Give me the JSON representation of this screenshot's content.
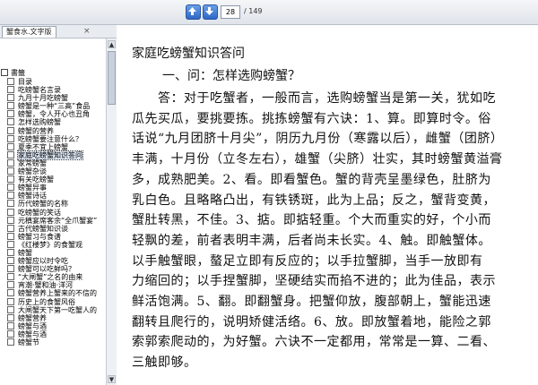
{
  "toolbar": {
    "current_page": "28",
    "total_pages": "/ 149",
    "prev_icon": "arrow-up-icon",
    "next_icon": "arrow-down-icon"
  },
  "sidebar": {
    "tab_label": "蟹食水.文字版",
    "root_label": "書籤",
    "items": [
      "目录",
      "吃螃蟹名言录",
      "九月十月吃螃蟹",
      "螃蟹是一种“三高”食品",
      "螃蟹，令人开心也丑角",
      "怎样选购螃蟹",
      "螃蟹的营养",
      "吃螃蟹要注意什么？",
      "夏季不宜上螃蟹",
      "家庭吃螃蟹知识答问",
      "家常螃蟹",
      "螃蟹杂谈",
      "有关吃螃蟹",
      "螃蟹异事",
      "螃蟹诗话",
      "历代螃蟹的名称",
      "吃螃蟹的笑话",
      "元稹宴席客余“全爪蟹宴”",
      "古代螃蟹知识谈",
      "螃蟹习与食谱",
      "《红楼梦》的食蟹观",
      "螃蟹",
      "螃蟹应以时令吃",
      "螃蟹可以吃鲜吗？",
      "“大闸蟹”之名的由来",
      "宵潮·蟹和油·洋河",
      "螃蟹营养上蟹来的不信的",
      "历史上的食蟹风俗",
      "大闸蟹天下第一吃蟹人的",
      "螃蟹营养",
      "螃蟹与酒",
      "螃蟹与酒",
      "螃蟹节"
    ],
    "selected_index": 9
  },
  "document": {
    "title": "家庭吃螃蟹知识答问",
    "question": "一、问：怎样选购螃蟹？",
    "lines": [
      "　　答：对于吃蟹者，一般而言，选购螃蟹当是第一关，犹如吃",
      "瓜先买瓜，要挑要拣。挑拣螃蟹有六诀：1、算。即算时令。俗",
      "话说“九月团脐十月尖”，阴历九月份（寒露以后），雌蟹（团脐）",
      "丰满，十月份（立冬左右），雄蟹（尖脐）壮实，其时螃蟹黄溢膏",
      "多，成熟肥美。2、看。即看蟹色。蟹的背壳呈墨绿色，肚脐为",
      "乳白色。且略略凸出，有铁锈斑，此为上品；反之，蟹背变黄，",
      "蟹肚转黑，不佳。3、掂。即掂轻重。个大而重实的好，个小而",
      "轻飘的差，前者表明丰满，后者尚未长实。4、触。即触蟹体。",
      "以手触蟹眼，螯足立即有反应的；以手拉蟹脚，当手一放即有",
      "力缩回的；以手捏蟹脚，坚硬结实而掐不进的；此为佳品，表示",
      "鲜活饱满。5、翻。即翻蟹身。把蟹仰放，腹部朝上，蟹能迅速",
      "翻转且爬行的，说明矫健活络。6、放。即放蟹着地，能险之郭",
      "索郭索爬动的，为好蟹。六诀不一定都用，常常是一算、二看、",
      "三触即够。"
    ]
  }
}
